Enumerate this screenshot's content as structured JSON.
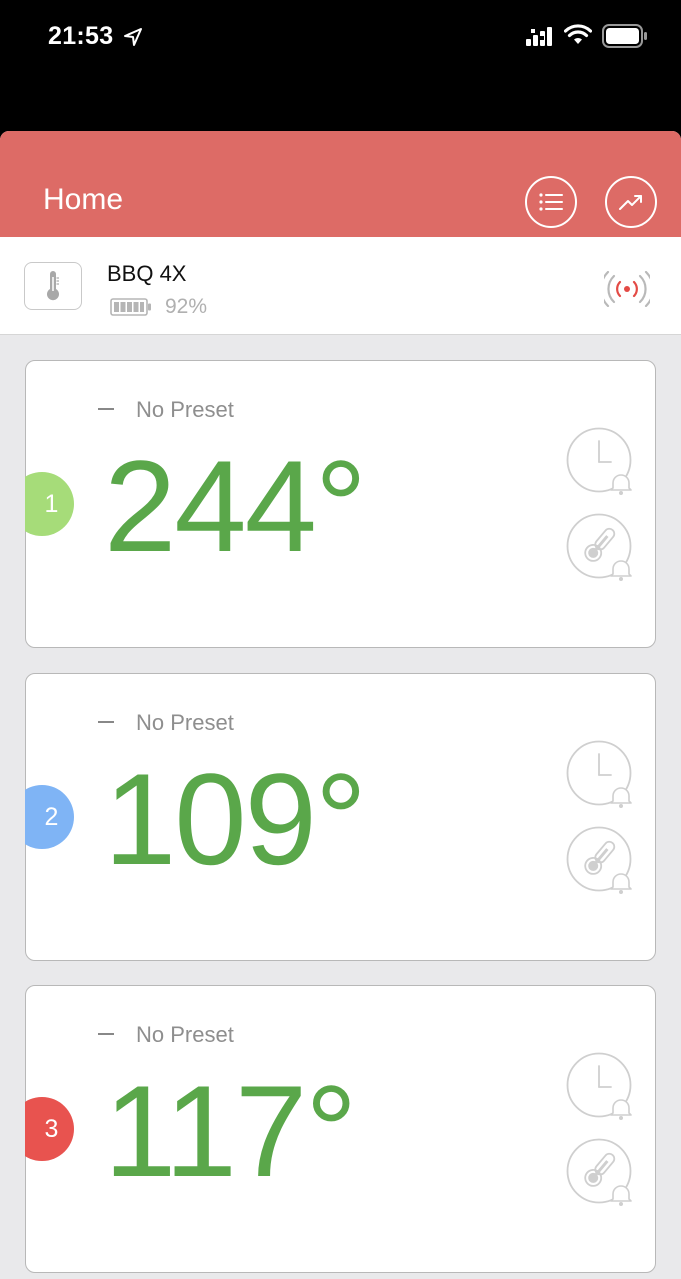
{
  "status_bar": {
    "time": "21:53"
  },
  "header": {
    "title": "Home",
    "icons": [
      "list-icon",
      "trend-chart-icon"
    ],
    "color": "#dd6b66"
  },
  "device": {
    "name": "BBQ 4X",
    "battery_percent": "92%",
    "battery_level": 0.92,
    "icons": [
      "thermometer-icon",
      "battery-icon",
      "bluetooth-signal-icon"
    ]
  },
  "probes": [
    {
      "number": "1",
      "preset": "No Preset",
      "temperature": "244°",
      "badge_color": "#a6dc79"
    },
    {
      "number": "2",
      "preset": "No Preset",
      "temperature": "109°",
      "badge_color": "#7fb4f5"
    },
    {
      "number": "3",
      "preset": "No Preset",
      "temperature": "117°",
      "badge_color": "#e8534f"
    }
  ],
  "colors": {
    "temperature_text": "#5aa74a",
    "background": "#e9e9eb"
  }
}
